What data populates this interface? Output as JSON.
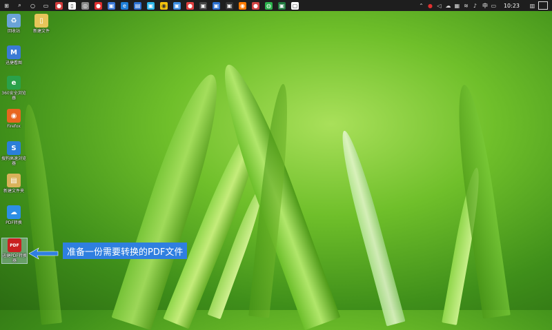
{
  "taskbar": {
    "icons": [
      {
        "name": "windows-start-icon",
        "color": "#1e1e1e"
      },
      {
        "name": "search-icon",
        "color": "#1e1e1e"
      },
      {
        "name": "cortana-icon",
        "color": "#1e1e1e"
      },
      {
        "name": "task-view-icon",
        "color": "#1e1e1e"
      },
      {
        "name": "app-icon-1",
        "color": "#d23c3c"
      },
      {
        "name": "file-icon",
        "color": "#ffffff"
      },
      {
        "name": "media-icon",
        "color": "#888888"
      },
      {
        "name": "app-icon-2",
        "color": "#e03030"
      },
      {
        "name": "app-icon-3",
        "color": "#3b79d8"
      },
      {
        "name": "edge-icon",
        "color": "#1f7fd8"
      },
      {
        "name": "app-icon-4",
        "color": "#2a6fd0"
      },
      {
        "name": "app-icon-5",
        "color": "#2bb5e8"
      },
      {
        "name": "chrome-icon",
        "color": "#f4c20d"
      },
      {
        "name": "app-icon-6",
        "color": "#3c8de0"
      },
      {
        "name": "app-icon-7",
        "color": "#e04040"
      },
      {
        "name": "app-icon-8",
        "color": "#444444"
      },
      {
        "name": "app-icon-9",
        "color": "#2a6fd0"
      },
      {
        "name": "app-icon-10",
        "color": "#333333"
      },
      {
        "name": "app-icon-11",
        "color": "#ff7a00"
      },
      {
        "name": "app-icon-12",
        "color": "#d24444"
      },
      {
        "name": "wechat-icon",
        "color": "#2bb24c"
      },
      {
        "name": "excel-icon",
        "color": "#1f7a3f"
      },
      {
        "name": "app-icon-13",
        "color": "#ffffff"
      }
    ],
    "tray": {
      "ime": "中",
      "clock": "10:23"
    }
  },
  "desktop": {
    "icons": [
      {
        "label": "回收站",
        "color": "#6aa3d8",
        "glyph": "♻"
      },
      {
        "label": "新建文件",
        "color": "#e7c55a",
        "glyph": "▯"
      },
      {
        "label": "迅捷看图",
        "color": "#3a7bd5",
        "glyph": "M"
      },
      {
        "label": "360安全浏览器",
        "color": "#2aa14a",
        "glyph": "e"
      },
      {
        "label": "Firefox",
        "color": "#e8661f",
        "glyph": "◉"
      },
      {
        "label": "搜狗高速浏览器",
        "color": "#2b7fd8",
        "glyph": "S"
      },
      {
        "label": "新建文件夹",
        "color": "#d9b25a",
        "glyph": "▤"
      },
      {
        "label": "PDF转换",
        "color": "#2d8fe6",
        "glyph": "☁"
      },
      {
        "label": "迅捷PDF转换器",
        "color": "#c92020",
        "glyph": "PDF"
      }
    ]
  },
  "callout": {
    "text": "准备一份需要转换的PDF文件"
  },
  "colors": {
    "callout_bg": "#2f7fe0",
    "arrow": "#2f7fe0"
  }
}
